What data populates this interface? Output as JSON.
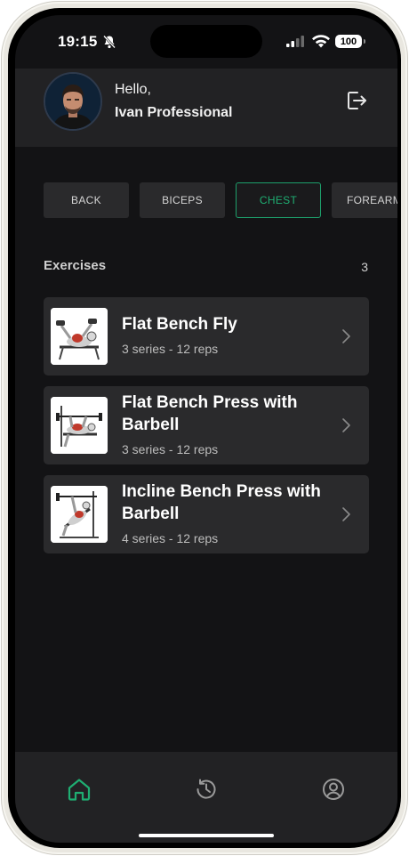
{
  "status_bar": {
    "time": "19:15",
    "battery": "100"
  },
  "header": {
    "greeting": "Hello,",
    "user_name": "Ivan Professional"
  },
  "tabs": [
    {
      "label": "BACK"
    },
    {
      "label": "BICEPS"
    },
    {
      "label": "CHEST",
      "active": true
    },
    {
      "label": "FOREARM"
    }
  ],
  "exercises": {
    "title": "Exercises",
    "count": "3",
    "items": [
      {
        "name": "Flat Bench Fly",
        "detail": "3 series - 12 reps"
      },
      {
        "name": "Flat Bench Press with Barbell",
        "detail": "3 series - 12 reps"
      },
      {
        "name": "Incline Bench Press with Barbell",
        "detail": "4 series - 12 reps"
      }
    ]
  },
  "nav": {
    "items": [
      "home-icon",
      "history-icon",
      "profile-icon"
    ],
    "active": "home-icon"
  },
  "colors": {
    "accent": "#1fae72",
    "background": "#131315",
    "card": "#2a2a2c",
    "header": "#222224"
  }
}
